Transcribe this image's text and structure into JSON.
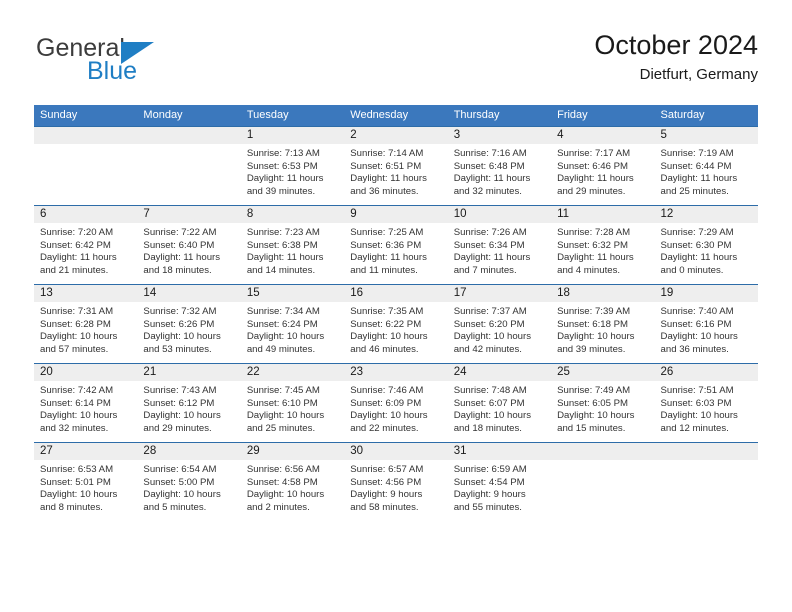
{
  "brand": {
    "name_part1": "General",
    "name_part2": "Blue",
    "accent_color": "#1f7ec4"
  },
  "header": {
    "title": "October 2024",
    "subtitle": "Dietfurt, Germany"
  },
  "theme": {
    "header_row_bg": "#3b78bd",
    "day_band_bg": "#eeeeee",
    "row_divider": "#2d6ca8"
  },
  "weekdays": [
    "Sunday",
    "Monday",
    "Tuesday",
    "Wednesday",
    "Thursday",
    "Friday",
    "Saturday"
  ],
  "weeks": [
    [
      {
        "day": "",
        "sunrise": "",
        "sunset": "",
        "daylight1": "",
        "daylight2": "",
        "empty": true
      },
      {
        "day": "",
        "sunrise": "",
        "sunset": "",
        "daylight1": "",
        "daylight2": "",
        "empty": true
      },
      {
        "day": "1",
        "sunrise": "Sunrise: 7:13 AM",
        "sunset": "Sunset: 6:53 PM",
        "daylight1": "Daylight: 11 hours",
        "daylight2": "and 39 minutes."
      },
      {
        "day": "2",
        "sunrise": "Sunrise: 7:14 AM",
        "sunset": "Sunset: 6:51 PM",
        "daylight1": "Daylight: 11 hours",
        "daylight2": "and 36 minutes."
      },
      {
        "day": "3",
        "sunrise": "Sunrise: 7:16 AM",
        "sunset": "Sunset: 6:48 PM",
        "daylight1": "Daylight: 11 hours",
        "daylight2": "and 32 minutes."
      },
      {
        "day": "4",
        "sunrise": "Sunrise: 7:17 AM",
        "sunset": "Sunset: 6:46 PM",
        "daylight1": "Daylight: 11 hours",
        "daylight2": "and 29 minutes."
      },
      {
        "day": "5",
        "sunrise": "Sunrise: 7:19 AM",
        "sunset": "Sunset: 6:44 PM",
        "daylight1": "Daylight: 11 hours",
        "daylight2": "and 25 minutes."
      }
    ],
    [
      {
        "day": "6",
        "sunrise": "Sunrise: 7:20 AM",
        "sunset": "Sunset: 6:42 PM",
        "daylight1": "Daylight: 11 hours",
        "daylight2": "and 21 minutes."
      },
      {
        "day": "7",
        "sunrise": "Sunrise: 7:22 AM",
        "sunset": "Sunset: 6:40 PM",
        "daylight1": "Daylight: 11 hours",
        "daylight2": "and 18 minutes."
      },
      {
        "day": "8",
        "sunrise": "Sunrise: 7:23 AM",
        "sunset": "Sunset: 6:38 PM",
        "daylight1": "Daylight: 11 hours",
        "daylight2": "and 14 minutes."
      },
      {
        "day": "9",
        "sunrise": "Sunrise: 7:25 AM",
        "sunset": "Sunset: 6:36 PM",
        "daylight1": "Daylight: 11 hours",
        "daylight2": "and 11 minutes."
      },
      {
        "day": "10",
        "sunrise": "Sunrise: 7:26 AM",
        "sunset": "Sunset: 6:34 PM",
        "daylight1": "Daylight: 11 hours",
        "daylight2": "and 7 minutes."
      },
      {
        "day": "11",
        "sunrise": "Sunrise: 7:28 AM",
        "sunset": "Sunset: 6:32 PM",
        "daylight1": "Daylight: 11 hours",
        "daylight2": "and 4 minutes."
      },
      {
        "day": "12",
        "sunrise": "Sunrise: 7:29 AM",
        "sunset": "Sunset: 6:30 PM",
        "daylight1": "Daylight: 11 hours",
        "daylight2": "and 0 minutes."
      }
    ],
    [
      {
        "day": "13",
        "sunrise": "Sunrise: 7:31 AM",
        "sunset": "Sunset: 6:28 PM",
        "daylight1": "Daylight: 10 hours",
        "daylight2": "and 57 minutes."
      },
      {
        "day": "14",
        "sunrise": "Sunrise: 7:32 AM",
        "sunset": "Sunset: 6:26 PM",
        "daylight1": "Daylight: 10 hours",
        "daylight2": "and 53 minutes."
      },
      {
        "day": "15",
        "sunrise": "Sunrise: 7:34 AM",
        "sunset": "Sunset: 6:24 PM",
        "daylight1": "Daylight: 10 hours",
        "daylight2": "and 49 minutes."
      },
      {
        "day": "16",
        "sunrise": "Sunrise: 7:35 AM",
        "sunset": "Sunset: 6:22 PM",
        "daylight1": "Daylight: 10 hours",
        "daylight2": "and 46 minutes."
      },
      {
        "day": "17",
        "sunrise": "Sunrise: 7:37 AM",
        "sunset": "Sunset: 6:20 PM",
        "daylight1": "Daylight: 10 hours",
        "daylight2": "and 42 minutes."
      },
      {
        "day": "18",
        "sunrise": "Sunrise: 7:39 AM",
        "sunset": "Sunset: 6:18 PM",
        "daylight1": "Daylight: 10 hours",
        "daylight2": "and 39 minutes."
      },
      {
        "day": "19",
        "sunrise": "Sunrise: 7:40 AM",
        "sunset": "Sunset: 6:16 PM",
        "daylight1": "Daylight: 10 hours",
        "daylight2": "and 36 minutes."
      }
    ],
    [
      {
        "day": "20",
        "sunrise": "Sunrise: 7:42 AM",
        "sunset": "Sunset: 6:14 PM",
        "daylight1": "Daylight: 10 hours",
        "daylight2": "and 32 minutes."
      },
      {
        "day": "21",
        "sunrise": "Sunrise: 7:43 AM",
        "sunset": "Sunset: 6:12 PM",
        "daylight1": "Daylight: 10 hours",
        "daylight2": "and 29 minutes."
      },
      {
        "day": "22",
        "sunrise": "Sunrise: 7:45 AM",
        "sunset": "Sunset: 6:10 PM",
        "daylight1": "Daylight: 10 hours",
        "daylight2": "and 25 minutes."
      },
      {
        "day": "23",
        "sunrise": "Sunrise: 7:46 AM",
        "sunset": "Sunset: 6:09 PM",
        "daylight1": "Daylight: 10 hours",
        "daylight2": "and 22 minutes."
      },
      {
        "day": "24",
        "sunrise": "Sunrise: 7:48 AM",
        "sunset": "Sunset: 6:07 PM",
        "daylight1": "Daylight: 10 hours",
        "daylight2": "and 18 minutes."
      },
      {
        "day": "25",
        "sunrise": "Sunrise: 7:49 AM",
        "sunset": "Sunset: 6:05 PM",
        "daylight1": "Daylight: 10 hours",
        "daylight2": "and 15 minutes."
      },
      {
        "day": "26",
        "sunrise": "Sunrise: 7:51 AM",
        "sunset": "Sunset: 6:03 PM",
        "daylight1": "Daylight: 10 hours",
        "daylight2": "and 12 minutes."
      }
    ],
    [
      {
        "day": "27",
        "sunrise": "Sunrise: 6:53 AM",
        "sunset": "Sunset: 5:01 PM",
        "daylight1": "Daylight: 10 hours",
        "daylight2": "and 8 minutes."
      },
      {
        "day": "28",
        "sunrise": "Sunrise: 6:54 AM",
        "sunset": "Sunset: 5:00 PM",
        "daylight1": "Daylight: 10 hours",
        "daylight2": "and 5 minutes."
      },
      {
        "day": "29",
        "sunrise": "Sunrise: 6:56 AM",
        "sunset": "Sunset: 4:58 PM",
        "daylight1": "Daylight: 10 hours",
        "daylight2": "and 2 minutes."
      },
      {
        "day": "30",
        "sunrise": "Sunrise: 6:57 AM",
        "sunset": "Sunset: 4:56 PM",
        "daylight1": "Daylight: 9 hours",
        "daylight2": "and 58 minutes."
      },
      {
        "day": "31",
        "sunrise": "Sunrise: 6:59 AM",
        "sunset": "Sunset: 4:54 PM",
        "daylight1": "Daylight: 9 hours",
        "daylight2": "and 55 minutes."
      },
      {
        "day": "",
        "sunrise": "",
        "sunset": "",
        "daylight1": "",
        "daylight2": "",
        "empty": true
      },
      {
        "day": "",
        "sunrise": "",
        "sunset": "",
        "daylight1": "",
        "daylight2": "",
        "empty": true
      }
    ]
  ]
}
